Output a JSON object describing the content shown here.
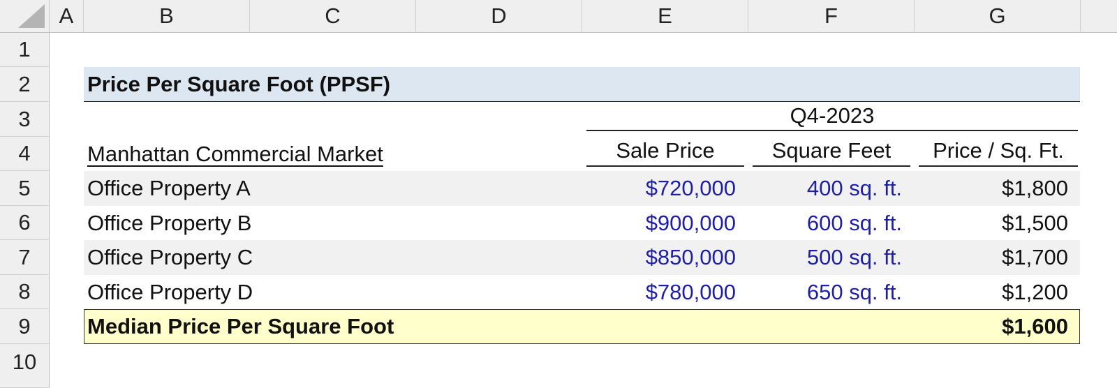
{
  "columns": [
    "A",
    "B",
    "C",
    "D",
    "E",
    "F",
    "G"
  ],
  "rows": [
    "1",
    "2",
    "3",
    "4",
    "5",
    "6",
    "7",
    "8",
    "9",
    "10"
  ],
  "table": {
    "title": "Price Per Square Foot (PPSF)",
    "period": "Q4-2023",
    "market_label": "Manhattan Commercial Market",
    "headers": {
      "sale_price": "Sale Price",
      "square_feet": "Square Feet",
      "price_per_sqft": "Price / Sq. Ft."
    },
    "properties": [
      {
        "name": "Office Property A",
        "sale_price": "$720,000",
        "square_feet": "400 sq. ft.",
        "price_per_sqft": "$1,800"
      },
      {
        "name": "Office Property B",
        "sale_price": "$900,000",
        "square_feet": "600 sq. ft.",
        "price_per_sqft": "$1,500"
      },
      {
        "name": "Office Property C",
        "sale_price": "$850,000",
        "square_feet": "500 sq. ft.",
        "price_per_sqft": "$1,700"
      },
      {
        "name": "Office Property D",
        "sale_price": "$780,000",
        "square_feet": "650 sq. ft.",
        "price_per_sqft": "$1,200"
      }
    ],
    "summary": {
      "label": "Median Price Per Square Foot",
      "value": "$1,600"
    }
  },
  "colors": {
    "title_band": "#dde7f1",
    "row_band": "#f1f1f1",
    "total_band": "#ffffcc",
    "input_text": "#1f1fa6"
  }
}
